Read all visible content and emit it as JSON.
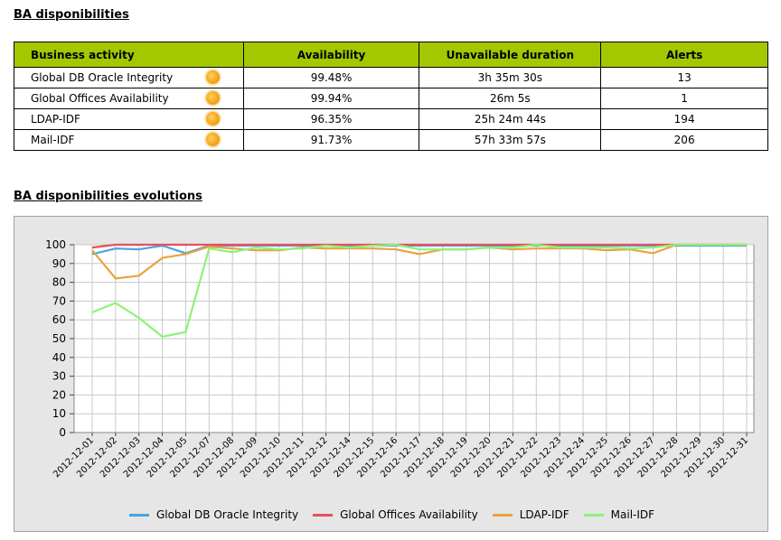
{
  "titles": {
    "availability": "BA disponibilities",
    "evolutions": "BA disponibilities evolutions"
  },
  "table": {
    "headers": [
      "Business activity",
      "Availability",
      "Unavailable duration",
      "Alerts"
    ],
    "rows": [
      {
        "name": "Global DB Oracle Integrity",
        "status_icon": "sun-icon",
        "availability": "99.48%",
        "duration": "3h 35m 30s",
        "alerts": "13"
      },
      {
        "name": "Global Offices Availability",
        "status_icon": "sun-icon",
        "availability": "99.94%",
        "duration": "26m 5s",
        "alerts": "1"
      },
      {
        "name": "LDAP-IDF",
        "status_icon": "sun-icon",
        "availability": "96.35%",
        "duration": "25h 24m 44s",
        "alerts": "194"
      },
      {
        "name": "Mail-IDF",
        "status_icon": "sun-icon",
        "availability": "91.73%",
        "duration": "57h 33m 57s",
        "alerts": "206"
      }
    ]
  },
  "chart_data": {
    "type": "line",
    "title": "",
    "xlabel": "",
    "ylabel": "",
    "ylim": [
      0,
      100
    ],
    "yticks": [
      0,
      10,
      20,
      30,
      40,
      50,
      60,
      70,
      80,
      90,
      100
    ],
    "grid": true,
    "legend_position": "bottom",
    "categories": [
      "2012-12-01",
      "2012-12-02",
      "2012-12-03",
      "2012-12-04",
      "2012-12-05",
      "2012-12-07",
      "2012-12-08",
      "2012-12-09",
      "2012-12-10",
      "2012-12-11",
      "2012-12-12",
      "2012-12-14",
      "2012-12-15",
      "2012-12-16",
      "2012-12-17",
      "2012-12-18",
      "2012-12-19",
      "2012-12-20",
      "2012-12-21",
      "2012-12-22",
      "2012-12-23",
      "2012-12-24",
      "2012-12-25",
      "2012-12-26",
      "2012-12-27",
      "2012-12-28",
      "2012-12-29",
      "2012-12-30",
      "2012-12-31"
    ],
    "series": [
      {
        "name": "Global DB Oracle Integrity",
        "color": "#4aa3df",
        "values": [
          95,
          98,
          97.5,
          99.5,
          95.5,
          99.5,
          99.5,
          99.5,
          99.5,
          99.5,
          99.5,
          99.5,
          99.5,
          99.5,
          99.5,
          99.5,
          99.5,
          99.5,
          99.5,
          99.5,
          99.5,
          99.5,
          99.5,
          99.5,
          99.5,
          99.5,
          99.5,
          99.5,
          99.5
        ]
      },
      {
        "name": "Global Offices Availability",
        "color": "#e8505a",
        "values": [
          98.5,
          100,
          100,
          100,
          100,
          100,
          100,
          100,
          100,
          100,
          100,
          100,
          100,
          100,
          100,
          100,
          100,
          100,
          100,
          100,
          100,
          100,
          100,
          100,
          100,
          100,
          100,
          100,
          100
        ]
      },
      {
        "name": "LDAP-IDF",
        "color": "#e8a33d",
        "values": [
          97,
          82,
          83.5,
          93,
          95,
          99,
          98,
          97,
          97,
          98.5,
          98,
          98,
          98,
          97.5,
          95,
          97.5,
          97.5,
          98.5,
          97.5,
          98,
          98,
          98,
          97,
          97.5,
          95.5,
          100,
          100,
          100,
          100
        ]
      },
      {
        "name": "Mail-IDF",
        "color": "#8ef27a",
        "values": [
          64,
          69,
          61,
          51,
          53.5,
          98,
          96,
          98.5,
          97.5,
          98,
          99.5,
          98.5,
          99.5,
          100,
          97.5,
          97.5,
          97.5,
          98.5,
          98.5,
          100,
          98.5,
          98.5,
          98.5,
          98,
          98.5,
          100,
          100,
          100,
          100
        ]
      }
    ]
  }
}
